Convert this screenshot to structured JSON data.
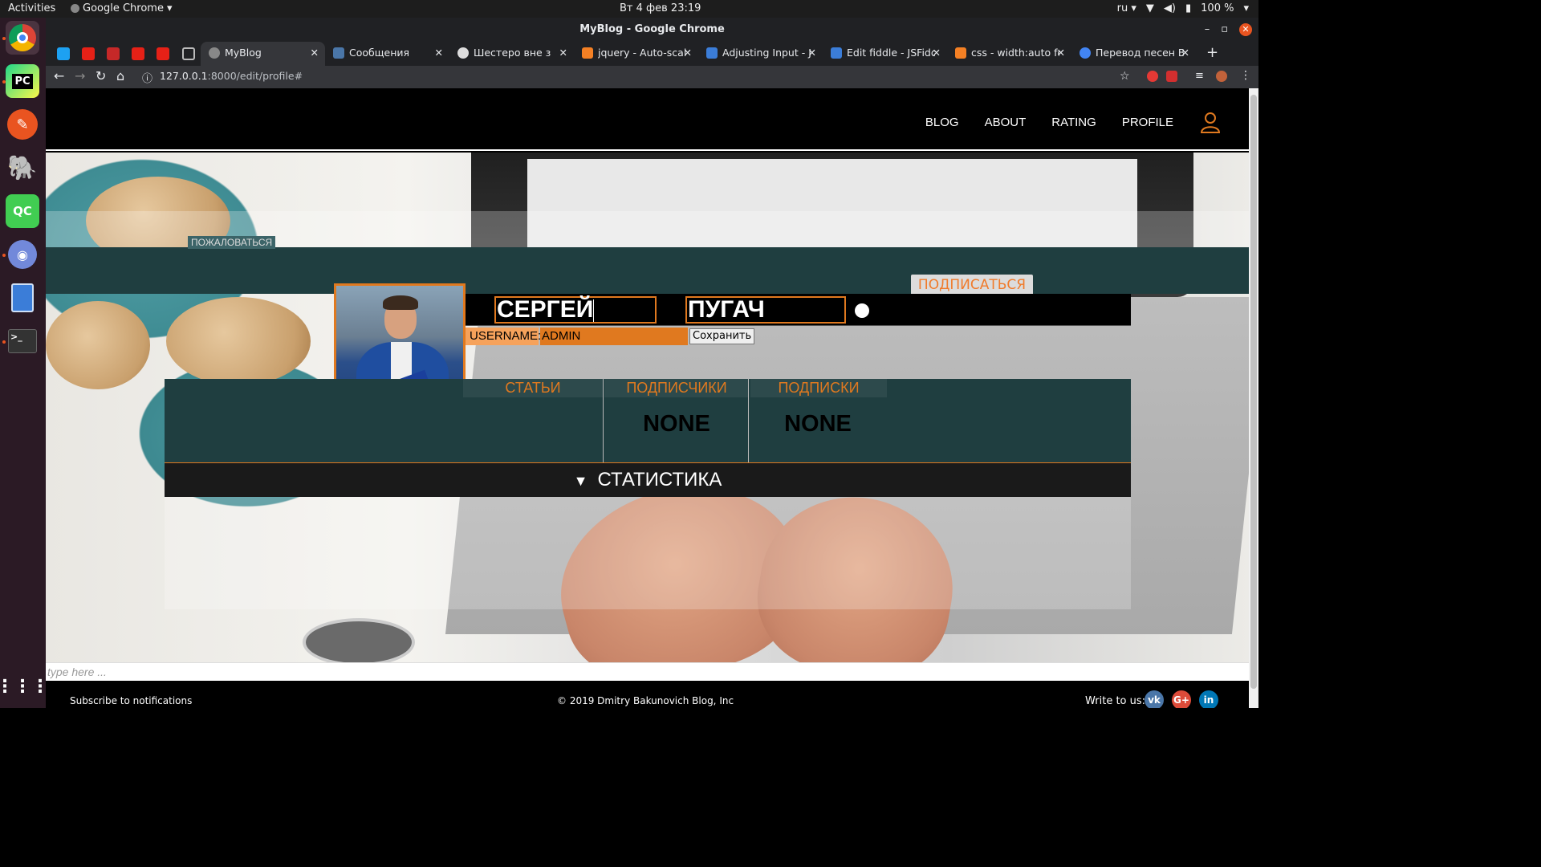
{
  "os_bar": {
    "activities": "Activities",
    "app_name": "Google Chrome",
    "clock": "Вт 4 фев  23:19",
    "keyboard_layout": "ru",
    "battery": "100 %"
  },
  "dock": {
    "items": [
      "chrome-icon",
      "pycharm-icon",
      "inkscape-icon",
      "postgres-icon",
      "qtcreator-icon",
      "discord-icon",
      "text-editor-icon",
      "terminal-icon",
      "app-grid-icon"
    ]
  },
  "window": {
    "title": "MyBlog - Google Chrome"
  },
  "tabs": [
    {
      "label": "MyBlog",
      "active": true
    },
    {
      "label": "Сообщения",
      "active": false
    },
    {
      "label": "Шестеро вне з",
      "active": false
    },
    {
      "label": "jquery - Auto-scali",
      "active": false
    },
    {
      "label": "Adjusting Input - J",
      "active": false
    },
    {
      "label": "Edit fiddle - JSFidd",
      "active": false
    },
    {
      "label": "css - width:auto fo",
      "active": false
    },
    {
      "label": "Перевод песен Bl",
      "active": false
    }
  ],
  "address_bar": {
    "host": "127.0.0.1",
    "path": ":8000/edit/profile#"
  },
  "site_nav": {
    "links": [
      "BLOG",
      "ABOUT",
      "RATING",
      "PROFILE"
    ]
  },
  "profile": {
    "report_label": "ПОЖАЛОВАТЬСЯ",
    "subscribe_label": "ПОДПИСАТЬСЯ",
    "first_name": "СЕРГЕЙ",
    "last_name": "ПУГАЧ",
    "username_label": "USERNAME:",
    "username_value": "ADMIN",
    "save_label": "Сохранить"
  },
  "stats": {
    "headers": [
      "СТАТЬИ",
      "ПОДПИСЧИКИ",
      "ПОДПИСКИ"
    ],
    "values": [
      "",
      "NONE",
      "NONE"
    ],
    "section_title": "СТАТИСТИКА"
  },
  "footer": {
    "input_placeholder": "type here ...",
    "subscribe_text": "Subscribe to notifications",
    "copyright": "© 2019 Dmitry Bakunovich Blog, Inc",
    "write_to_us": "Write to us:",
    "social": [
      "vk-icon",
      "google-plus-icon",
      "linkedin-icon"
    ]
  },
  "colors": {
    "accent": "#e0791f",
    "panel": "#1f3e40",
    "nav_bg": "#000000"
  }
}
